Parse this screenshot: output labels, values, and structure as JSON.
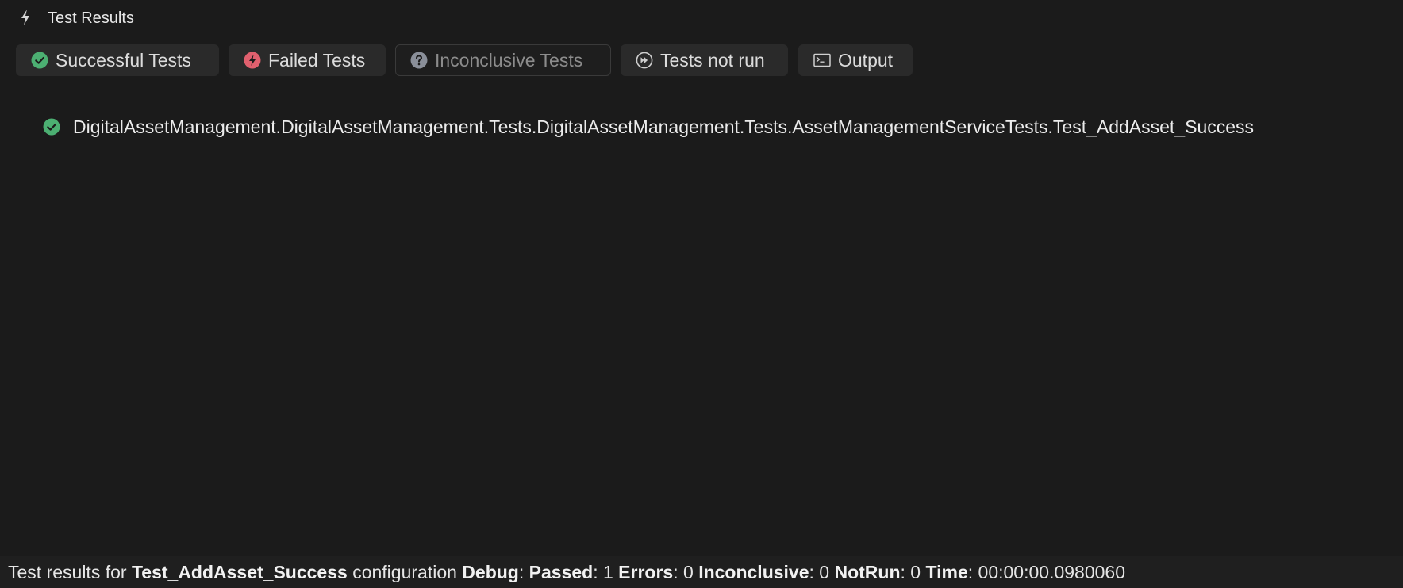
{
  "pad": {
    "title": "Test Results",
    "title_icon": "bolt-icon"
  },
  "toolbar": {
    "buttons": [
      {
        "label": "Successful Tests",
        "icon": "check-circle-icon",
        "color": "#4caf72"
      },
      {
        "label": "Failed Tests",
        "icon": "bolt-circle-icon",
        "color": "#e0606e"
      },
      {
        "label": "Inconclusive Tests",
        "icon": "question-circle-icon",
        "color": "#8a8f99"
      },
      {
        "label": "Tests not run",
        "icon": "fast-forward-circle-icon",
        "color": "#cfcfcf"
      },
      {
        "label": "Output",
        "icon": "terminal-icon",
        "color": "#cfcfcf"
      }
    ]
  },
  "results": [
    {
      "status_icon": "check-circle-icon",
      "name": "DigitalAssetManagement.DigitalAssetManagement.Tests.DigitalAssetManagement.Tests.AssetManagementServiceTests.Test_AddAsset_Success"
    }
  ],
  "status": {
    "prefix": "Test results for",
    "test_name": "Test_AddAsset_Success",
    "configuration_label": "configuration",
    "configuration": "Debug",
    "passed_label": "Passed",
    "passed": "1",
    "errors_label": "Errors",
    "errors": "0",
    "inconclusive_label": "Inconclusive",
    "inconclusive": "0",
    "notrun_label": "NotRun",
    "notrun": "0",
    "time_label": "Time",
    "time": "00:00:00.0980060"
  },
  "colors": {
    "background": "#1b1b1b",
    "button_bg": "#2a2a2a",
    "success": "#4caf72",
    "failure": "#e0606e"
  }
}
